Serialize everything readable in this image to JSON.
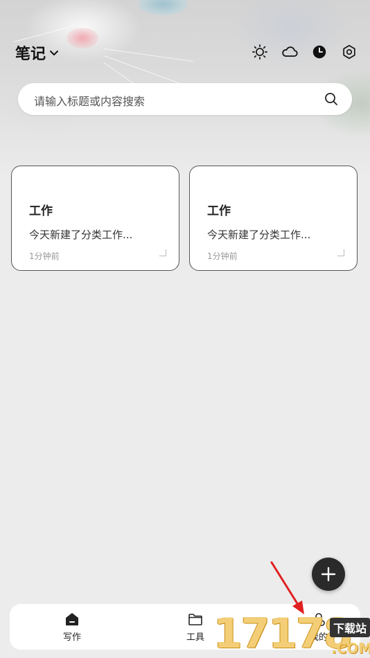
{
  "header": {
    "title": "笔记"
  },
  "top_icons": [
    "sun-icon",
    "cloud-icon",
    "clock-icon",
    "settings-icon"
  ],
  "search": {
    "placeholder": "请输入标题或内容搜索"
  },
  "notes": [
    {
      "title": "工作",
      "snippet": "今天新建了分类工作...",
      "time": "1分钟前"
    },
    {
      "title": "工作",
      "snippet": "今天新建了分类工作...",
      "time": "1分钟前"
    }
  ],
  "fab": {
    "icon": "plus-icon"
  },
  "bottom_nav": {
    "items": [
      {
        "label": "写作",
        "icon": "home-icon"
      },
      {
        "label": "工具",
        "icon": "folder-icon"
      },
      {
        "label": "我的",
        "icon": "user-icon"
      }
    ]
  },
  "watermark": {
    "digits": "17178",
    "badge": "下载站",
    "suffix": ".COM"
  },
  "colors": {
    "annotation_arrow": "#e02020",
    "fab": "#2a2a2a",
    "watermark": "#f3ce77"
  }
}
